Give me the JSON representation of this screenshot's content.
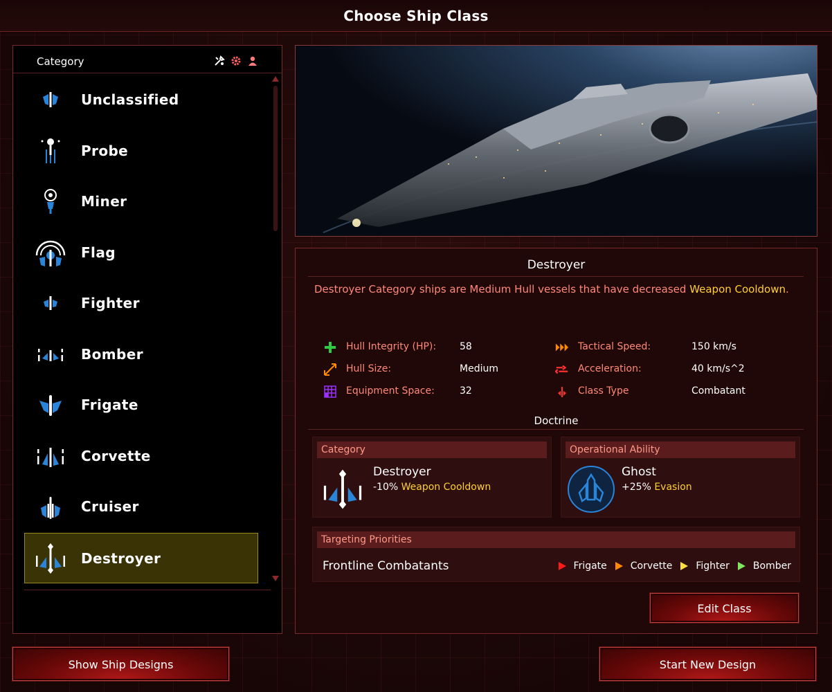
{
  "window": {
    "title": "Choose Ship Class"
  },
  "category_list": {
    "header": "Category",
    "header_icons": [
      "tools-icon",
      "gear-icon",
      "person-icon"
    ],
    "items": [
      {
        "label": "Unclassified"
      },
      {
        "label": "Probe"
      },
      {
        "label": "Miner"
      },
      {
        "label": "Flag"
      },
      {
        "label": "Fighter"
      },
      {
        "label": "Bomber"
      },
      {
        "label": "Frigate"
      },
      {
        "label": "Corvette"
      },
      {
        "label": "Cruiser"
      },
      {
        "label": "Destroyer",
        "selected": true
      }
    ]
  },
  "details": {
    "name": "Destroyer",
    "description_pre": "Destroyer Category ships are Medium Hull vessels that have decreased ",
    "description_highlight": "Weapon Cooldown",
    "description_post": ".",
    "stats": {
      "hull_integrity": {
        "label": "Hull Integrity (HP):",
        "value": "58",
        "icon": "plus-icon",
        "color": "#2ecc40"
      },
      "hull_size": {
        "label": "Hull Size:",
        "value": "Medium",
        "icon": "resize-icon",
        "color": "#ff8a00"
      },
      "equipment_space": {
        "label": "Equipment Space:",
        "value": "32",
        "icon": "grid-icon",
        "color": "#9b30ff"
      },
      "tactical_speed": {
        "label": "Tactical Speed:",
        "value": "150 km/s",
        "icon": "speed-arrows-icon",
        "color": "#ff8a00"
      },
      "acceleration": {
        "label": "Acceleration:",
        "value": "40 km/s^2",
        "icon": "acceleration-icon",
        "color": "#ff3030"
      },
      "class_type": {
        "label": "Class Type",
        "value": "Combatant",
        "icon": "ship-class-icon",
        "color": "#ff3030"
      }
    },
    "doctrine": {
      "title": "Doctrine",
      "category": {
        "header": "Category",
        "name": "Destroyer",
        "effect_value": "-10%",
        "effect_stat": "Weapon Cooldown"
      },
      "operational_ability": {
        "header": "Operational Ability",
        "name": "Ghost",
        "effect_value": "+25%",
        "effect_stat": "Evasion"
      },
      "targeting": {
        "header": "Targeting Priorities",
        "label": "Frontline Combatants",
        "priorities": [
          {
            "name": "Frigate",
            "color": "#ff1a1a"
          },
          {
            "name": "Corvette",
            "color": "#ff8a00"
          },
          {
            "name": "Fighter",
            "color": "#ffe040"
          },
          {
            "name": "Bomber",
            "color": "#7ee860"
          }
        ]
      }
    }
  },
  "buttons": {
    "edit_class": "Edit Class",
    "show_designs": "Show Ship Designs",
    "start_design": "Start New Design"
  }
}
